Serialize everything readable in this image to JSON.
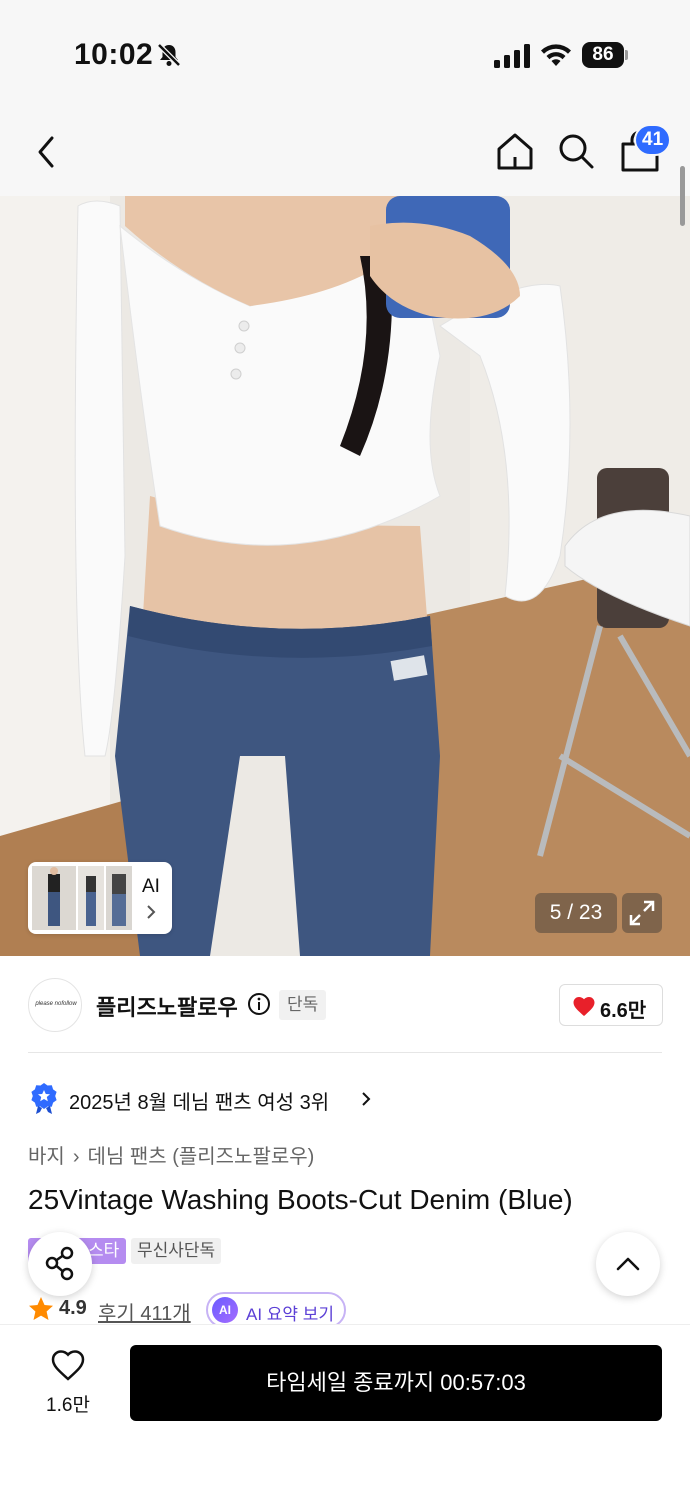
{
  "status_bar": {
    "time": "10:02",
    "battery": "86"
  },
  "header": {
    "cart_count": "41"
  },
  "image": {
    "ai_label": "AI",
    "counter": "5 / 23"
  },
  "brand": {
    "name": "플리즈노팔로우",
    "tag": "단독",
    "likes": "6.6만",
    "logo_text": "please nofollow"
  },
  "ranking": {
    "text": "2025년 8월 데님 팬츠 여성 3위"
  },
  "breadcrumb": {
    "level1": "바지",
    "level2": "데님 팬츠 (플리즈노팔로우)"
  },
  "product": {
    "title": "25Vintage Washing Boots-Cut Denim (Blue)",
    "tags": [
      "스타",
      "무신사단독"
    ],
    "rating": "4.9",
    "reviews": "후기 411개",
    "ai_summary": "AI 요약 보기",
    "ai_badge": "AI"
  },
  "bottom_bar": {
    "wishlist_count": "1.6만",
    "buy_label": "타임세일 종료까지 00:57:03"
  },
  "colors": {
    "accent_blue": "#2f6bff",
    "like_red": "#e8202a",
    "star_orange": "#ff8a00",
    "tag_purple": "#b58cf0"
  }
}
